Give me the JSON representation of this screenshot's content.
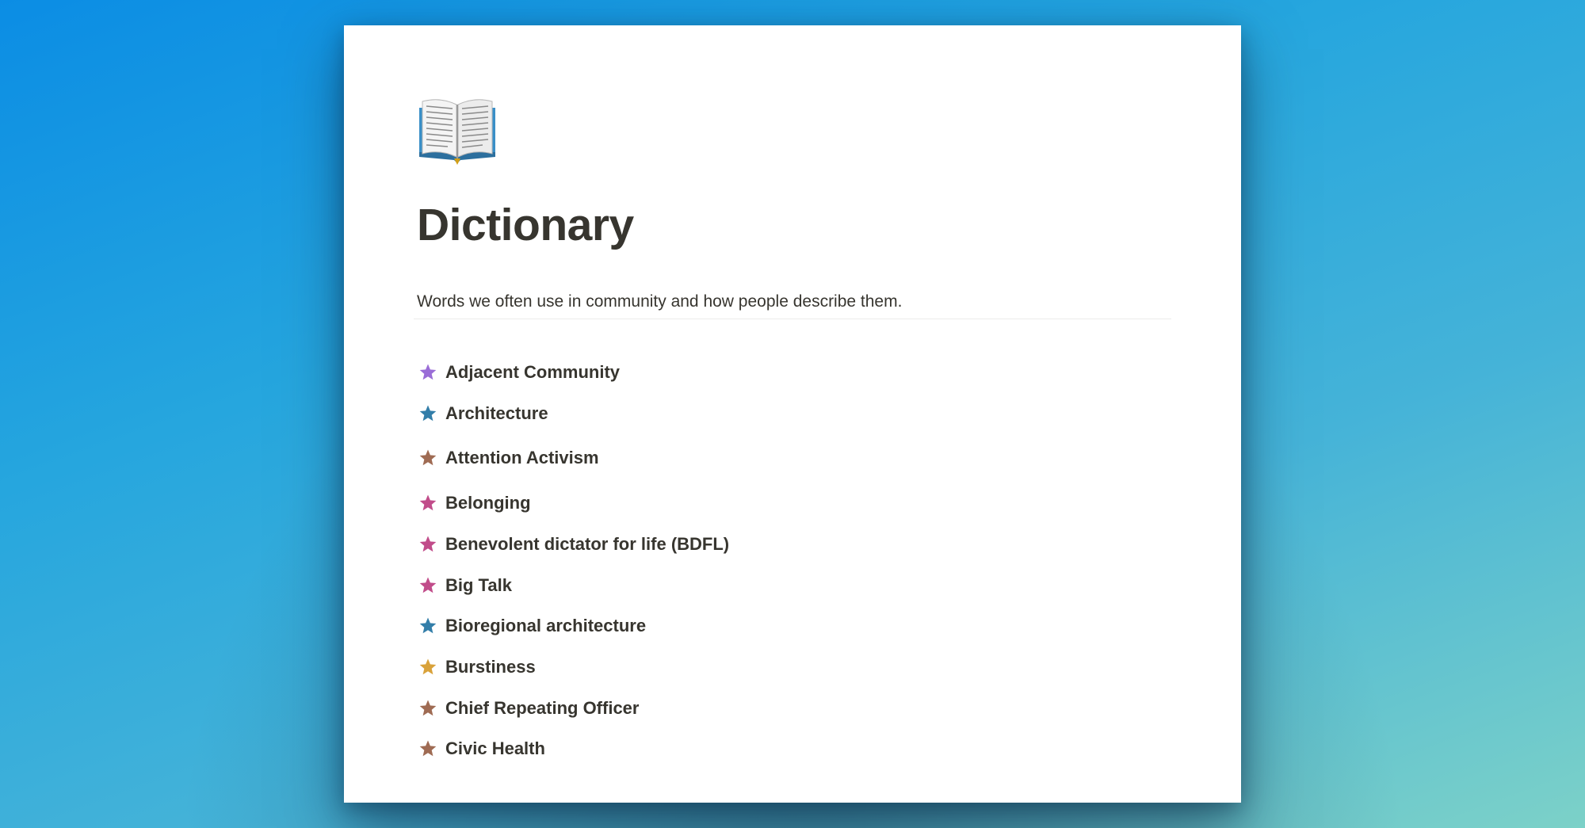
{
  "page": {
    "icon": "open-book-icon",
    "title": "Dictionary",
    "description": "Words we often use in community and how people describe them."
  },
  "items": [
    {
      "label": "Adjacent Community",
      "icon": "star-icon",
      "color": "#9a6dd7"
    },
    {
      "label": "Architecture",
      "icon": "star-icon",
      "color": "#337ea9"
    },
    {
      "label": "Attention Activism",
      "icon": "star-icon",
      "color": "#9f6b53"
    },
    {
      "label": "Belonging",
      "icon": "star-icon",
      "color": "#c14c8a"
    },
    {
      "label": "Benevolent dictator for life (BDFL)",
      "icon": "star-icon",
      "color": "#c14c8a"
    },
    {
      "label": "Big Talk",
      "icon": "star-icon",
      "color": "#c14c8a"
    },
    {
      "label": "Bioregional architecture",
      "icon": "star-icon",
      "color": "#337ea9"
    },
    {
      "label": "Burstiness",
      "icon": "star-icon",
      "color": "#d9a23a"
    },
    {
      "label": "Chief Repeating Officer",
      "icon": "star-icon",
      "color": "#9f6b53"
    },
    {
      "label": "Civic Health",
      "icon": "star-icon",
      "color": "#9f6b53"
    }
  ],
  "colors": {
    "text": "#37352f",
    "page_background": "#ffffff"
  }
}
